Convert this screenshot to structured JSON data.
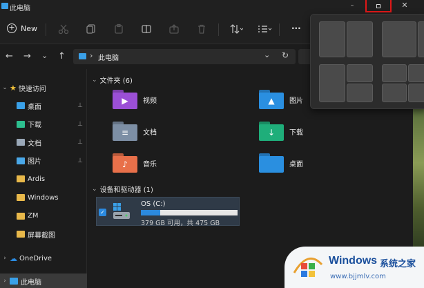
{
  "window": {
    "title": "此电脑",
    "min_label": "–",
    "close_label": "✕"
  },
  "toolbar": {
    "new_label": "New",
    "plus_glyph": "+",
    "more_glyph": "···"
  },
  "nav": {
    "back": "←",
    "forward": "→",
    "recent": "⌄",
    "up": "↑"
  },
  "address": {
    "separator": "›",
    "path": "此电脑",
    "dropdown": "⌄",
    "refresh": "↻"
  },
  "sidebar": {
    "quick_access": "快速访问",
    "items": [
      {
        "label": "桌面",
        "pinned": true,
        "color": "#3aa0e8"
      },
      {
        "label": "下载",
        "pinned": true,
        "color": "#2dbf8f"
      },
      {
        "label": "文档",
        "pinned": true,
        "color": "#9aa8b8"
      },
      {
        "label": "图片",
        "pinned": true,
        "color": "#4aa8e8"
      },
      {
        "label": "Ardis",
        "pinned": false,
        "color": "#e8b84a"
      },
      {
        "label": "Windows",
        "pinned": false,
        "color": "#e8b84a"
      },
      {
        "label": "ZM",
        "pinned": false,
        "color": "#e8b84a"
      },
      {
        "label": "屏幕截图",
        "pinned": false,
        "color": "#e8b84a"
      }
    ],
    "onedrive": "OneDrive",
    "this_pc": "此电脑",
    "pin_glyph": "📌"
  },
  "main": {
    "folders_header": "文件夹 (6)",
    "folders": [
      {
        "label": "视频",
        "color": "#9b4fd6",
        "glyph": "▶"
      },
      {
        "label": "图片",
        "color": "#2a8fe0",
        "glyph": "▲"
      },
      {
        "label": "文档",
        "color": "#7d8fa5",
        "glyph": "≡"
      },
      {
        "label": "下载",
        "color": "#1fae7a",
        "glyph": "↓"
      },
      {
        "label": "音乐",
        "color": "#e8704a",
        "glyph": "♪"
      },
      {
        "label": "桌面",
        "color": "#2a8fe0",
        "glyph": ""
      }
    ],
    "devices_header": "设备和驱动器 (1)",
    "drive": {
      "name": "OS (C:)",
      "info": "379 GB 可用，共 475 GB",
      "used_fraction": 0.2,
      "check": "✓"
    }
  },
  "watermark": {
    "brand": "Windows",
    "brand_cn": "系统之家",
    "url": "www.bjjmlv.com"
  }
}
